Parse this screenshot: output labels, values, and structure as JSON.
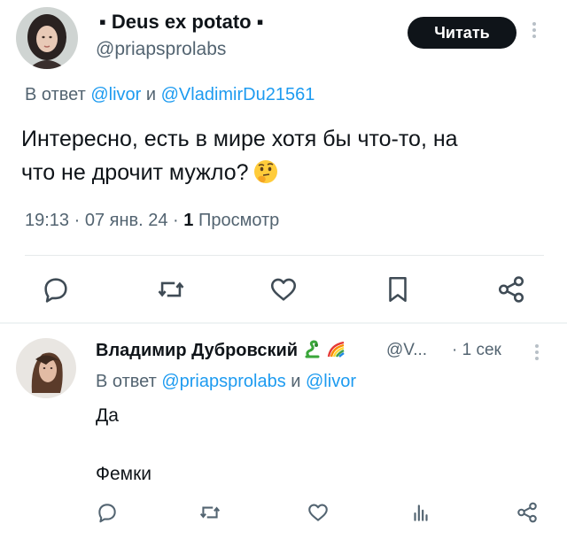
{
  "main_tweet": {
    "author_name": "▪ Deus ex potato ▪",
    "handle": "@priapsprolabs",
    "follow_label": "Читать",
    "reply_prefix": "В ответ ",
    "reply_user1": "@livor",
    "reply_conj": " и ",
    "reply_user2": "@VladimirDu21561",
    "text_line1": "Интересно, есть в мире хотя бы что-то, на",
    "text_line2": "что не дрочит мужло?",
    "emoji": "thinking-face",
    "time": "19:13 · 07 янв. 24 · ",
    "views_count": "1",
    "views_label": " Просмотр"
  },
  "reply_tweet": {
    "author_name": "Владимир Дубровский",
    "badges": [
      "snake-emoji",
      "rainbow-emoji"
    ],
    "handle": "@V...",
    "time": "· 1 сек",
    "reply_prefix": "В ответ ",
    "reply_user1": "@priapsprolabs",
    "reply_conj": " и ",
    "reply_user2": "@livor",
    "text_line1": "Да",
    "text_line2": "Фемки"
  },
  "colors": {
    "link": "#1d9bf0",
    "text": "#0f1419",
    "secondary": "#536471",
    "button_bg": "#0f1419"
  },
  "icons": {
    "actions": [
      "reply-icon",
      "retweet-icon",
      "like-icon",
      "bookmark-icon",
      "share-icon"
    ],
    "reply_actions": [
      "reply-icon",
      "retweet-icon",
      "like-icon",
      "views-icon",
      "share-icon"
    ]
  }
}
